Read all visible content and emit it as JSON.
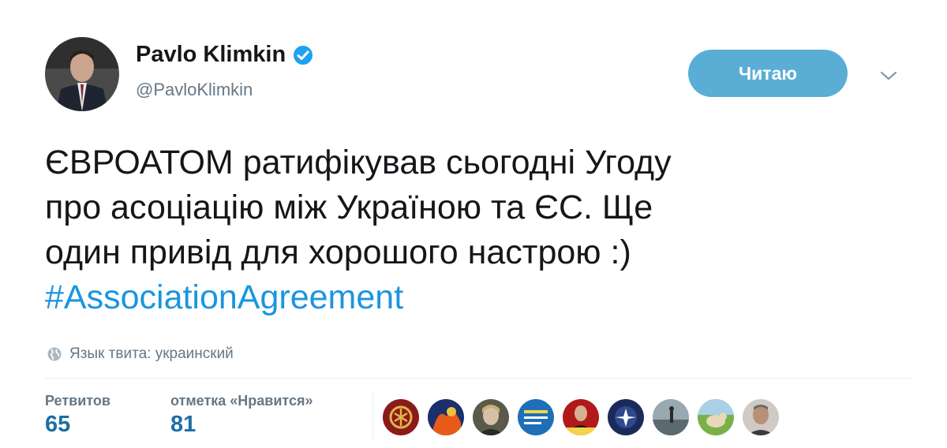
{
  "author": {
    "display_name": "Pavlo Klimkin",
    "screen_name": "@PavloKlimkin",
    "verified": true
  },
  "follow_button_label": "Читаю",
  "tweet": {
    "lines": [
      "ЄВРОАТОМ ратифікував сьогодні Угоду",
      "про асоціацію між Україною та ЄС. Ще",
      "один привід для хорошого настрою :)"
    ],
    "hashtag": "#AssociationAgreement"
  },
  "language_note": "Язык твита: украинский",
  "stats": {
    "retweets_label": "Ретвитов",
    "retweets_count": "65",
    "likes_label": "отметка «Нравится»",
    "likes_count": "81"
  },
  "likers_count_shown": 9,
  "colors": {
    "follow_button": "#5aaed5",
    "hashtag": "#1b95e0",
    "stat_value": "#1c6fa3",
    "secondary_text": "#657786",
    "verified_badge": "#1da1f2"
  },
  "icons": {
    "verified": "verified-badge-icon",
    "caret": "chevron-down-icon",
    "language": "globe-icon"
  }
}
